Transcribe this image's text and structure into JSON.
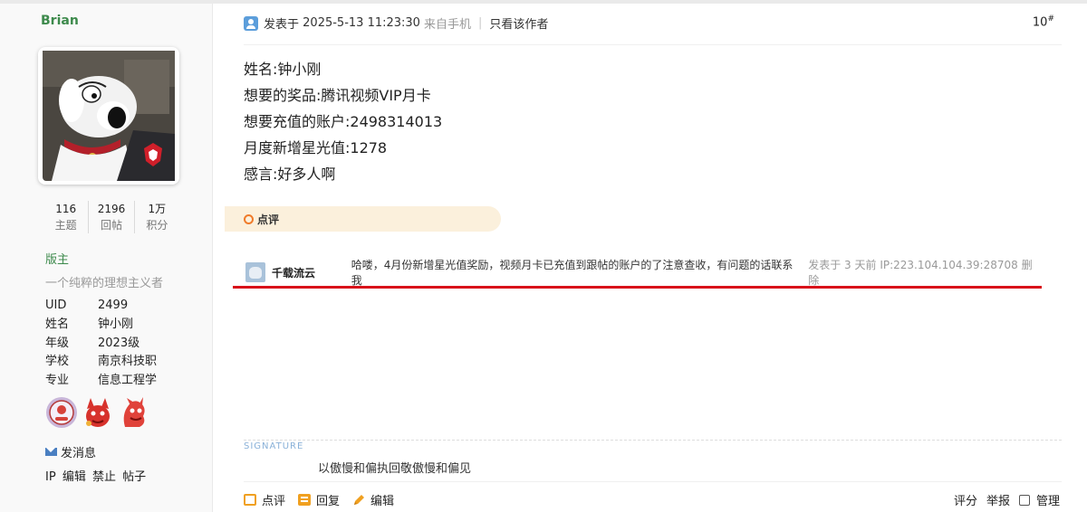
{
  "user": {
    "name": "Brian",
    "stats": [
      {
        "num": "116",
        "label": "主题"
      },
      {
        "num": "2196",
        "label": "回帖"
      },
      {
        "num": "1万",
        "label": "积分"
      }
    ],
    "role": "版主",
    "motto": "一个纯粹的理想主义者",
    "info": [
      {
        "key": "UID",
        "value": "2499"
      },
      {
        "key": "姓名",
        "value": "钟小刚"
      },
      {
        "key": "年级",
        "value": "2023级"
      },
      {
        "key": "学校",
        "value": "南京科技职"
      },
      {
        "key": "专业",
        "value": "信息工程学"
      }
    ],
    "send_message": "发消息",
    "admin_links": [
      "IP",
      "编辑",
      "禁止",
      "帖子"
    ]
  },
  "post": {
    "posted_prefix": "发表于",
    "posted_time": "2025-5-13 11:23:30",
    "device": "来自手机",
    "only_author": "只看该作者",
    "floor": "10",
    "floor_sup": "#",
    "lines": [
      "姓名:钟小刚",
      "想要的奖品:腾讯视频VIP月卡",
      "想要充值的账户:2498314013",
      "月度新增星光值:1278",
      "感言:好多人啊"
    ],
    "dianping_label": "点评",
    "comment": {
      "author": "千载流云",
      "text": "哈喽，4月份新增星光值奖励，视频月卡已充值到跟帖的账户的了注意查收，有问题的话联系我",
      "meta": "发表于 3 天前 IP:223.104.104.39:28708 删除"
    },
    "signature_title": "SIGNATURE",
    "signature": "以傲慢和偏执回敬傲慢和偏见",
    "actions": {
      "dianping": "点评",
      "reply": "回复",
      "edit": "编辑"
    },
    "right_actions": {
      "rate": "评分",
      "report": "举报",
      "manage": "管理"
    }
  },
  "colors": {
    "accent_green": "#3d8a4c",
    "highlight_red": "#d9111a",
    "dianping_bg": "#fbf0dc",
    "action_orange": "#f0a020"
  }
}
